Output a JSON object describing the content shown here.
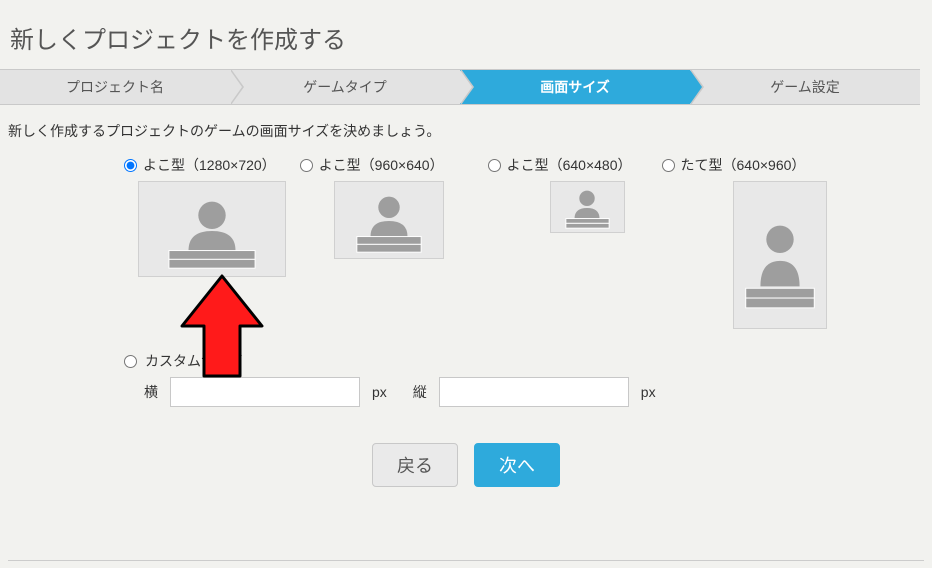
{
  "page": {
    "title": "新しくプロジェクトを作成する",
    "description": "新しく作成するプロジェクトのゲームの画面サイズを決めましょう。"
  },
  "steps": [
    {
      "label": "プロジェクト名",
      "active": false
    },
    {
      "label": "ゲームタイプ",
      "active": false
    },
    {
      "label": "画面サイズ",
      "active": true
    },
    {
      "label": "ゲーム設定",
      "active": false
    }
  ],
  "sizeOptions": [
    {
      "label": "よこ型（1280×720）",
      "checked": true
    },
    {
      "label": "よこ型（960×640）",
      "checked": false
    },
    {
      "label": "よこ型（640×480）",
      "checked": false
    },
    {
      "label": "たて型（640×960）",
      "checked": false
    }
  ],
  "custom": {
    "label": "カスタムサイズ",
    "widthLabel": "横",
    "heightLabel": "縦",
    "unit": "px",
    "widthValue": "",
    "heightValue": ""
  },
  "buttons": {
    "back": "戻る",
    "next": "次へ"
  }
}
